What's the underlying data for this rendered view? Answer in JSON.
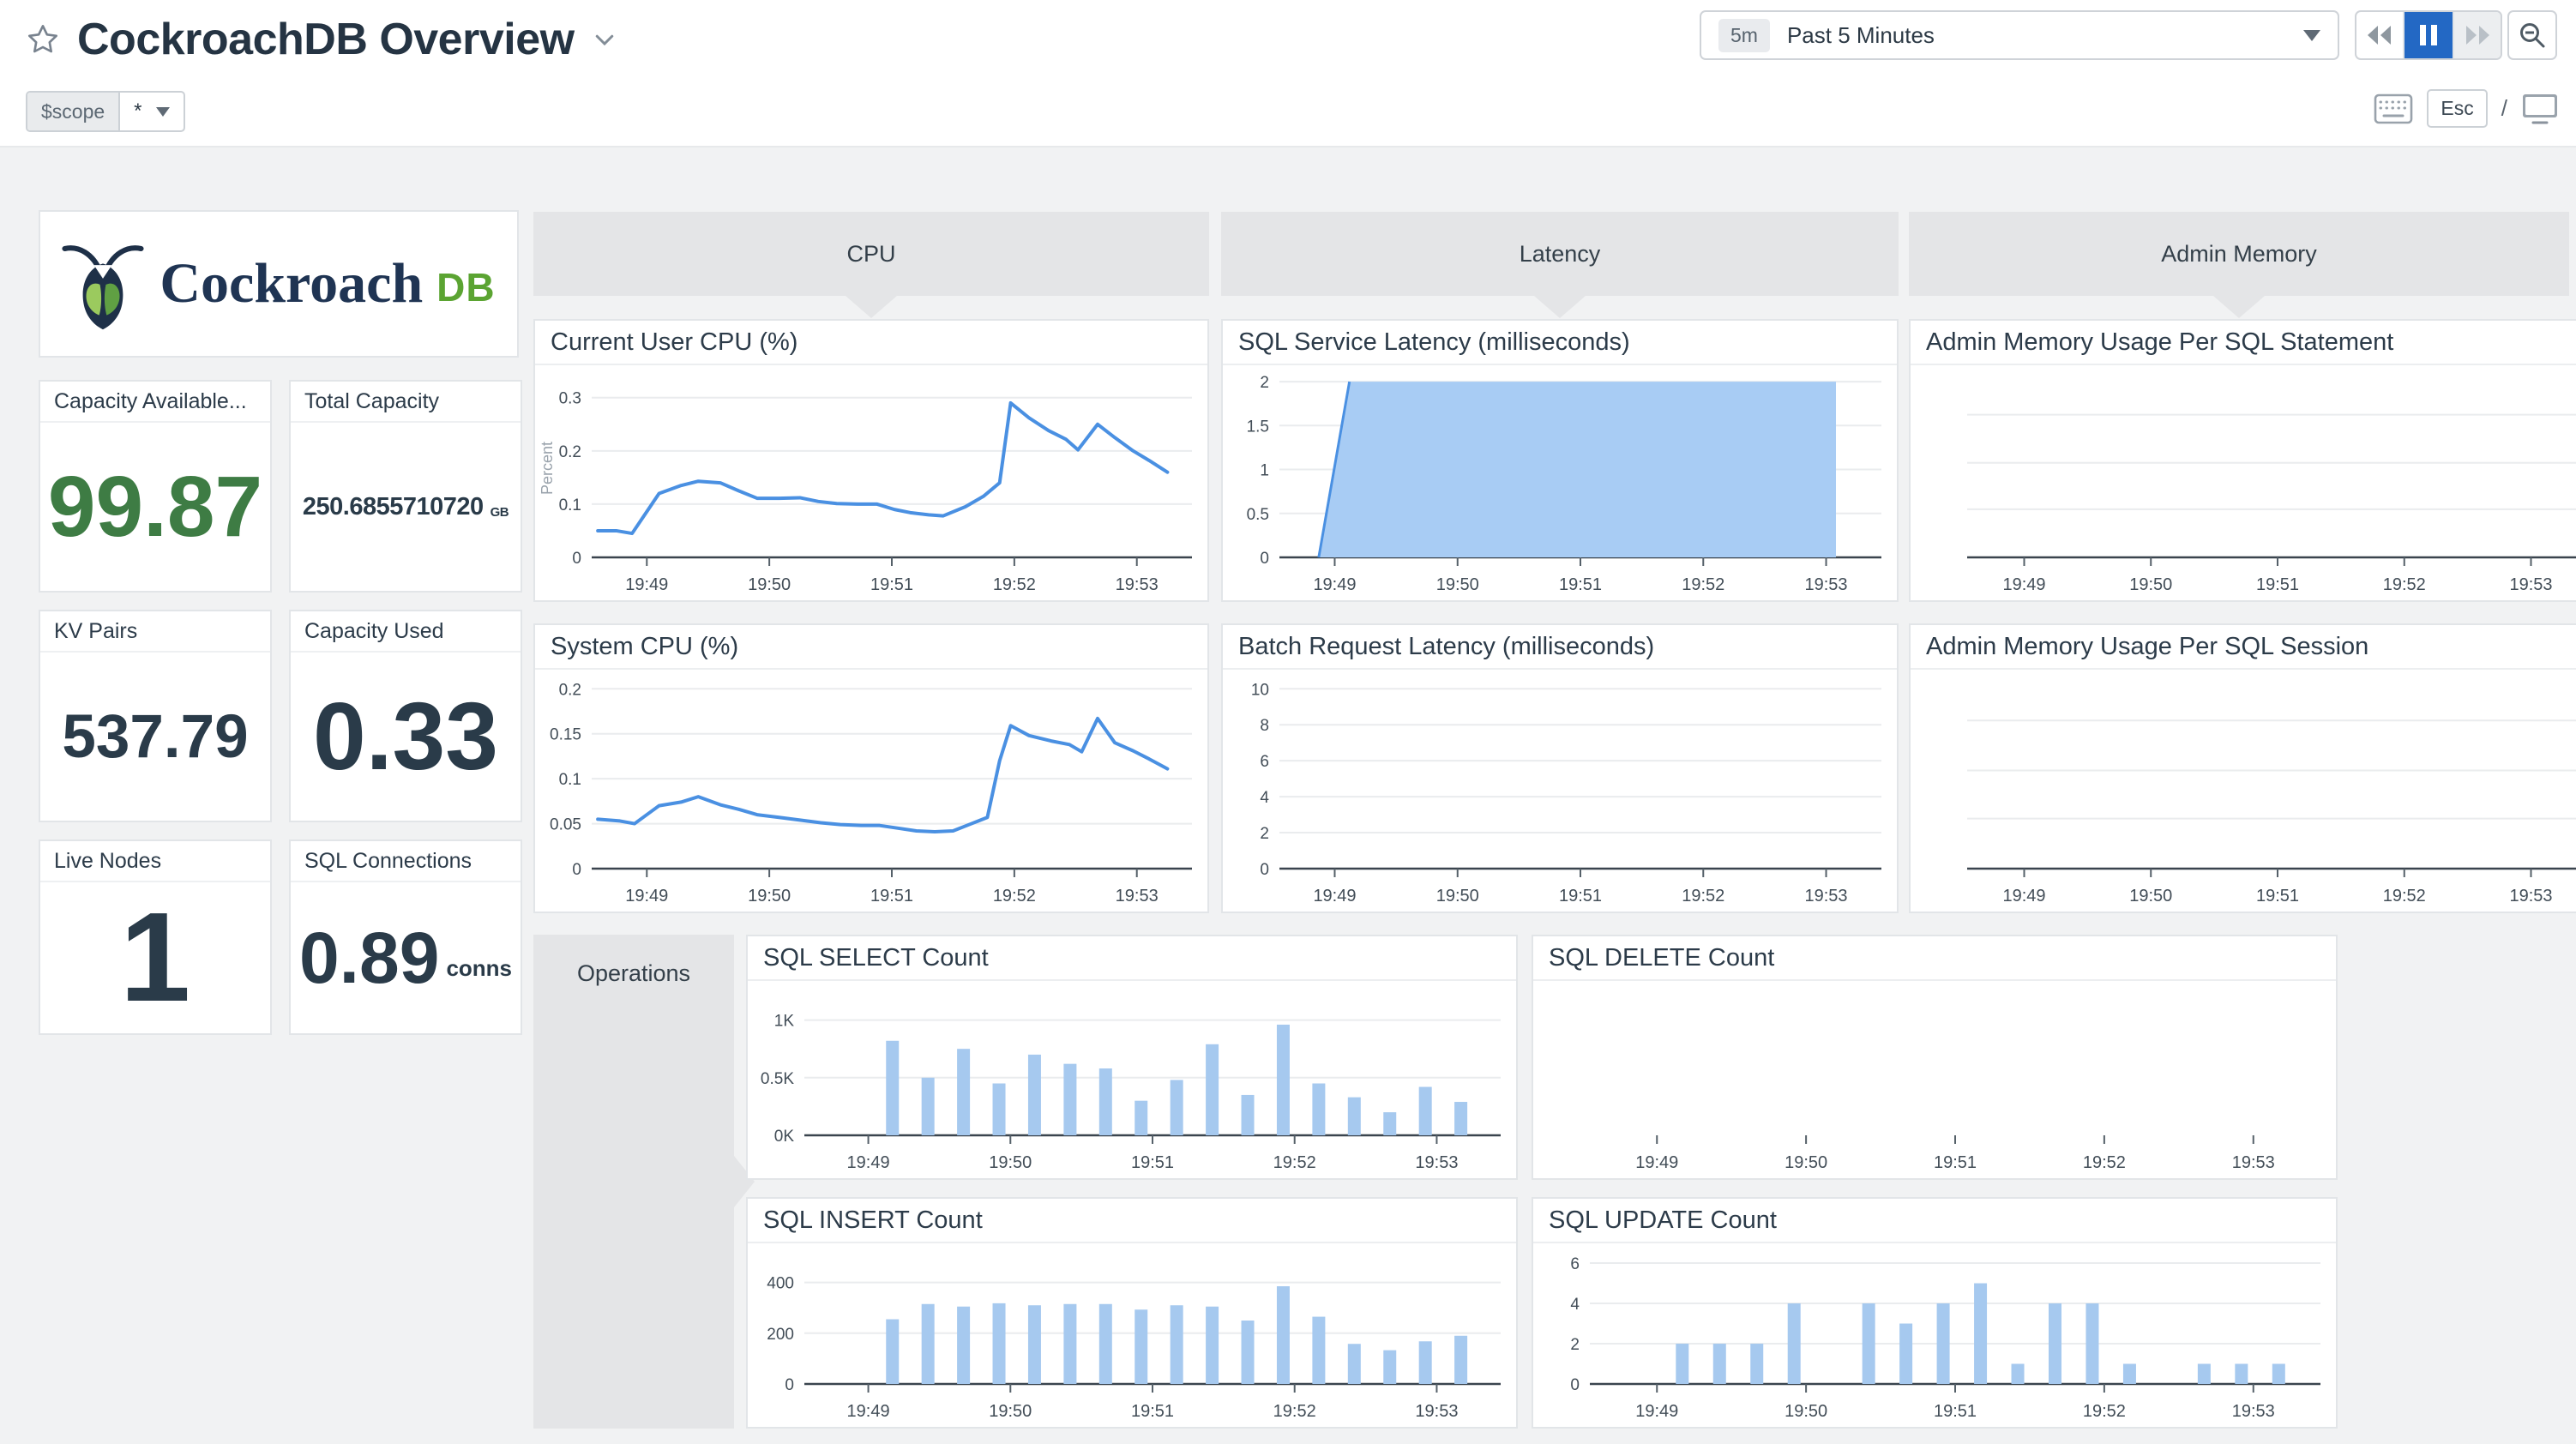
{
  "header": {
    "title": "CockroachDB Overview",
    "time": {
      "badge": "5m",
      "label": "Past 5 Minutes"
    },
    "esc": "Esc",
    "slash": "/"
  },
  "scope": {
    "name": "$scope",
    "value": "*"
  },
  "logo": {
    "word": "Cockroach",
    "suffix": "DB"
  },
  "groups": {
    "cpu": "CPU",
    "latency": "Latency",
    "admin_memory": "Admin Memory",
    "operations": "Operations"
  },
  "metrics": [
    {
      "title": "Capacity Available...",
      "value": "99.87",
      "unit": ""
    },
    {
      "title": "Total Capacity",
      "value": "250.6855710720",
      "unit": "GB"
    },
    {
      "title": "KV Pairs",
      "value": "537.79",
      "unit": ""
    },
    {
      "title": "Capacity Used",
      "value": "0.33",
      "unit": ""
    },
    {
      "title": "Live Nodes",
      "value": "1",
      "unit": ""
    },
    {
      "title": "SQL Connections",
      "value": "0.89",
      "unit": "conns"
    }
  ],
  "colors": {
    "line_blue": "#4a90e2",
    "area_fill": "#a8ccf4",
    "bar_fill": "#a6c9ef",
    "grid": "#eaecee",
    "axis": "#3a444e",
    "tick_text": "#424d57",
    "value_green": "#3e7c44",
    "value_navy": "#2a3b49",
    "pause_blue": "#2368c4"
  },
  "chart_data": [
    {
      "id": "current_user_cpu",
      "type": "line",
      "title": "Current User CPU (%)",
      "ylabel": "Percent",
      "x_range": [
        48.55,
        53.45
      ],
      "x_ticks": [
        [
          49,
          "19:49"
        ],
        [
          50,
          "19:50"
        ],
        [
          51,
          "19:51"
        ],
        [
          52,
          "19:52"
        ],
        [
          53,
          "19:53"
        ]
      ],
      "y_ticks": [
        [
          0,
          "0"
        ],
        [
          0.1,
          "0.1"
        ],
        [
          0.2,
          "0.2"
        ],
        [
          0.3,
          "0.3"
        ]
      ],
      "y_max": 0.335,
      "points": [
        [
          48.6,
          0.05
        ],
        [
          48.75,
          0.05
        ],
        [
          48.88,
          0.045
        ],
        [
          49.1,
          0.12
        ],
        [
          49.28,
          0.135
        ],
        [
          49.42,
          0.143
        ],
        [
          49.6,
          0.14
        ],
        [
          49.75,
          0.125
        ],
        [
          49.9,
          0.111
        ],
        [
          50.08,
          0.111
        ],
        [
          50.25,
          0.112
        ],
        [
          50.4,
          0.105
        ],
        [
          50.55,
          0.101
        ],
        [
          50.72,
          0.1
        ],
        [
          50.88,
          0.1
        ],
        [
          51.02,
          0.09
        ],
        [
          51.15,
          0.084
        ],
        [
          51.3,
          0.08
        ],
        [
          51.42,
          0.078
        ],
        [
          51.6,
          0.095
        ],
        [
          51.75,
          0.115
        ],
        [
          51.88,
          0.14
        ],
        [
          51.97,
          0.29
        ],
        [
          52.12,
          0.262
        ],
        [
          52.28,
          0.238
        ],
        [
          52.42,
          0.222
        ],
        [
          52.52,
          0.202
        ],
        [
          52.68,
          0.25
        ],
        [
          52.82,
          0.225
        ],
        [
          52.97,
          0.2
        ],
        [
          53.1,
          0.182
        ],
        [
          53.25,
          0.16
        ]
      ]
    },
    {
      "id": "system_cpu",
      "type": "line",
      "title": "System CPU (%)",
      "x_range": [
        48.55,
        53.45
      ],
      "x_ticks": [
        [
          49,
          "19:49"
        ],
        [
          50,
          "19:50"
        ],
        [
          51,
          "19:51"
        ],
        [
          52,
          "19:52"
        ],
        [
          53,
          "19:53"
        ]
      ],
      "y_ticks": [
        [
          0,
          "0"
        ],
        [
          0.05,
          "0.05"
        ],
        [
          0.1,
          "0.1"
        ],
        [
          0.15,
          "0.15"
        ],
        [
          0.2,
          "0.2"
        ]
      ],
      "y_max": 0.206,
      "points": [
        [
          48.6,
          0.055
        ],
        [
          48.78,
          0.053
        ],
        [
          48.9,
          0.05
        ],
        [
          49.1,
          0.07
        ],
        [
          49.28,
          0.074
        ],
        [
          49.42,
          0.08
        ],
        [
          49.6,
          0.071
        ],
        [
          49.75,
          0.066
        ],
        [
          49.9,
          0.06
        ],
        [
          50.08,
          0.057
        ],
        [
          50.25,
          0.054
        ],
        [
          50.42,
          0.051
        ],
        [
          50.58,
          0.049
        ],
        [
          50.75,
          0.048
        ],
        [
          50.9,
          0.048
        ],
        [
          51.05,
          0.045
        ],
        [
          51.2,
          0.042
        ],
        [
          51.35,
          0.041
        ],
        [
          51.5,
          0.042
        ],
        [
          51.65,
          0.05
        ],
        [
          51.78,
          0.057
        ],
        [
          51.88,
          0.12
        ],
        [
          51.97,
          0.159
        ],
        [
          52.12,
          0.148
        ],
        [
          52.3,
          0.142
        ],
        [
          52.45,
          0.138
        ],
        [
          52.55,
          0.13
        ],
        [
          52.68,
          0.167
        ],
        [
          52.82,
          0.14
        ],
        [
          52.97,
          0.131
        ],
        [
          53.1,
          0.122
        ],
        [
          53.25,
          0.111
        ]
      ]
    },
    {
      "id": "sql_service_latency",
      "type": "area",
      "title": "SQL Service Latency (milliseconds)",
      "x_range": [
        48.55,
        53.45
      ],
      "x_ticks": [
        [
          49,
          "19:49"
        ],
        [
          50,
          "19:50"
        ],
        [
          51,
          "19:51"
        ],
        [
          52,
          "19:52"
        ],
        [
          53,
          "19:53"
        ]
      ],
      "y_ticks": [
        [
          0,
          "0"
        ],
        [
          0.5,
          "0.5"
        ],
        [
          1,
          "1"
        ],
        [
          1.5,
          "1.5"
        ],
        [
          2,
          "2"
        ]
      ],
      "y_max": 2.03,
      "points": [
        [
          48.87,
          0
        ],
        [
          49.12,
          2
        ],
        [
          53.08,
          2
        ],
        [
          53.08,
          0
        ]
      ]
    },
    {
      "id": "batch_request_latency",
      "type": "line",
      "title": "Batch Request Latency (milliseconds)",
      "x_range": [
        48.55,
        53.45
      ],
      "x_ticks": [
        [
          49,
          "19:49"
        ],
        [
          50,
          "19:50"
        ],
        [
          51,
          "19:51"
        ],
        [
          52,
          "19:52"
        ],
        [
          53,
          "19:53"
        ]
      ],
      "y_ticks": [
        [
          0,
          "0"
        ],
        [
          2,
          "2"
        ],
        [
          4,
          "4"
        ],
        [
          6,
          "6"
        ],
        [
          8,
          "8"
        ],
        [
          10,
          "10"
        ]
      ],
      "y_max": 10.3,
      "points": []
    },
    {
      "id": "admin_mem_statement",
      "type": "line",
      "title": "Admin Memory Usage Per SQL Statement",
      "x_range": [
        48.55,
        53.45
      ],
      "x_ticks": [
        [
          49,
          "19:49"
        ],
        [
          50,
          "19:50"
        ],
        [
          51,
          "19:51"
        ],
        [
          52,
          "19:52"
        ],
        [
          53,
          "19:53"
        ]
      ],
      "y_ticks": [
        [
          2.7,
          ""
        ],
        [
          5.3,
          ""
        ],
        [
          8,
          ""
        ]
      ],
      "y_max": 10,
      "points": []
    },
    {
      "id": "admin_mem_session",
      "type": "line",
      "title": "Admin Memory Usage Per SQL Session",
      "x_range": [
        48.55,
        53.45
      ],
      "x_ticks": [
        [
          49,
          "19:49"
        ],
        [
          50,
          "19:50"
        ],
        [
          51,
          "19:51"
        ],
        [
          52,
          "19:52"
        ],
        [
          53,
          "19:53"
        ]
      ],
      "y_ticks": [
        [
          2.7,
          ""
        ],
        [
          5.3,
          ""
        ],
        [
          8,
          ""
        ]
      ],
      "y_max": 10,
      "points": []
    },
    {
      "id": "sql_select_count",
      "type": "bar",
      "title": "SQL SELECT Count",
      "x_range": [
        48.55,
        53.45
      ],
      "x_ticks": [
        [
          49,
          "19:49"
        ],
        [
          50,
          "19:50"
        ],
        [
          51,
          "19:51"
        ],
        [
          52,
          "19:52"
        ],
        [
          53,
          "19:53"
        ]
      ],
      "y_ticks": [
        [
          0,
          "0K"
        ],
        [
          0.5,
          "0.5K"
        ],
        [
          1,
          "1K"
        ]
      ],
      "y_max": 1.22,
      "bar_start": 49.17,
      "bar_step": 0.25,
      "values": [
        0.82,
        0.5,
        0.75,
        0.45,
        0.7,
        0.62,
        0.58,
        0.3,
        0.48,
        0.79,
        0.35,
        0.96,
        0.45,
        0.33,
        0.2,
        0.42,
        0.29
      ]
    },
    {
      "id": "sql_delete_count",
      "type": "bar",
      "title": "SQL DELETE Count",
      "x_range": [
        48.55,
        53.45
      ],
      "x_ticks": [
        [
          49,
          "19:49"
        ],
        [
          50,
          "19:50"
        ],
        [
          51,
          "19:51"
        ],
        [
          52,
          "19:52"
        ],
        [
          53,
          "19:53"
        ]
      ],
      "y_ticks": [],
      "y_max": 1,
      "baseline": false,
      "bar_start": 49.17,
      "bar_step": 0.25,
      "values": []
    },
    {
      "id": "sql_insert_count",
      "type": "bar",
      "title": "SQL INSERT Count",
      "x_range": [
        48.55,
        53.45
      ],
      "x_ticks": [
        [
          49,
          "19:49"
        ],
        [
          50,
          "19:50"
        ],
        [
          51,
          "19:51"
        ],
        [
          52,
          "19:52"
        ],
        [
          53,
          "19:53"
        ]
      ],
      "y_ticks": [
        [
          0,
          "0"
        ],
        [
          200,
          "200"
        ],
        [
          400,
          "400"
        ]
      ],
      "y_max": 500,
      "bar_start": 49.17,
      "bar_step": 0.25,
      "values": [
        255,
        315,
        305,
        318,
        310,
        315,
        315,
        293,
        310,
        305,
        250,
        385,
        265,
        158,
        133,
        168,
        190
      ]
    },
    {
      "id": "sql_update_count",
      "type": "bar",
      "title": "SQL UPDATE Count",
      "x_range": [
        48.55,
        53.45
      ],
      "x_ticks": [
        [
          49,
          "19:49"
        ],
        [
          50,
          "19:50"
        ],
        [
          51,
          "19:51"
        ],
        [
          52,
          "19:52"
        ],
        [
          53,
          "19:53"
        ]
      ],
      "y_ticks": [
        [
          0,
          "0"
        ],
        [
          2,
          "2"
        ],
        [
          4,
          "4"
        ],
        [
          6,
          "6"
        ]
      ],
      "y_max": 6.3,
      "bar_start": 49.17,
      "bar_step": 0.25,
      "values": [
        2,
        2,
        2,
        4,
        0,
        4,
        3,
        4,
        5,
        1,
        4,
        4,
        1,
        0,
        1,
        1,
        1
      ]
    }
  ]
}
